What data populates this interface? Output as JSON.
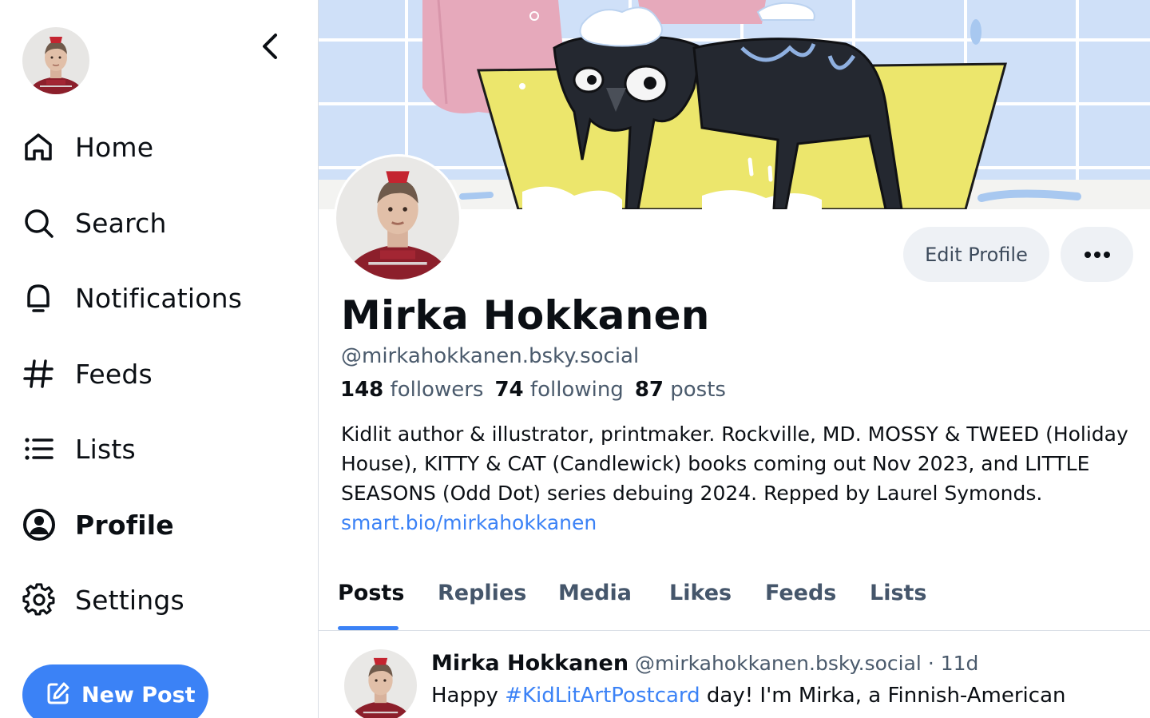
{
  "sidebar": {
    "items": [
      {
        "label": "Home",
        "icon": "home-icon"
      },
      {
        "label": "Search",
        "icon": "search-icon"
      },
      {
        "label": "Notifications",
        "icon": "bell-icon"
      },
      {
        "label": "Feeds",
        "icon": "hash-icon"
      },
      {
        "label": "Lists",
        "icon": "list-icon"
      },
      {
        "label": "Profile",
        "icon": "user-circle-icon",
        "active": true
      },
      {
        "label": "Settings",
        "icon": "gear-icon"
      }
    ],
    "new_post_label": "New Post"
  },
  "profile": {
    "display_name": "Mirka Hokkanen",
    "handle": "@mirkahokkanen.bsky.social",
    "followers_count": "148",
    "followers_label": "followers",
    "following_count": "74",
    "following_label": "following",
    "posts_count": "87",
    "posts_label": "posts",
    "bio": "Kidlit author & illustrator, printmaker. Rockville, MD. MOSSY & TWEED (Holiday House), KITTY & CAT (Candlewick) books coming out Nov 2023, and LITTLE SEASONS (Odd Dot) series debuing 2024. Repped by Laurel Symonds.",
    "bio_link": "smart.bio/mirkahokkanen",
    "edit_label": "Edit Profile"
  },
  "tabs": [
    {
      "label": "Posts",
      "active": true
    },
    {
      "label": "Replies"
    },
    {
      "label": "Media"
    },
    {
      "label": "Likes"
    },
    {
      "label": "Feeds"
    },
    {
      "label": "Lists"
    }
  ],
  "post": {
    "author": "Mirka Hokkanen",
    "handle": "@mirkahokkanen.bsky.social",
    "separator": "·",
    "age": "11d",
    "text_before": "Happy ",
    "hashtag": "#KidLitArtPostcard",
    "text_after": " day! I'm Mirka, a Finnish-American"
  },
  "colors": {
    "accent": "#3b82f6",
    "text": "#0b0f14",
    "muted": "#4a5a6c",
    "button_bg": "#eef1f5"
  }
}
